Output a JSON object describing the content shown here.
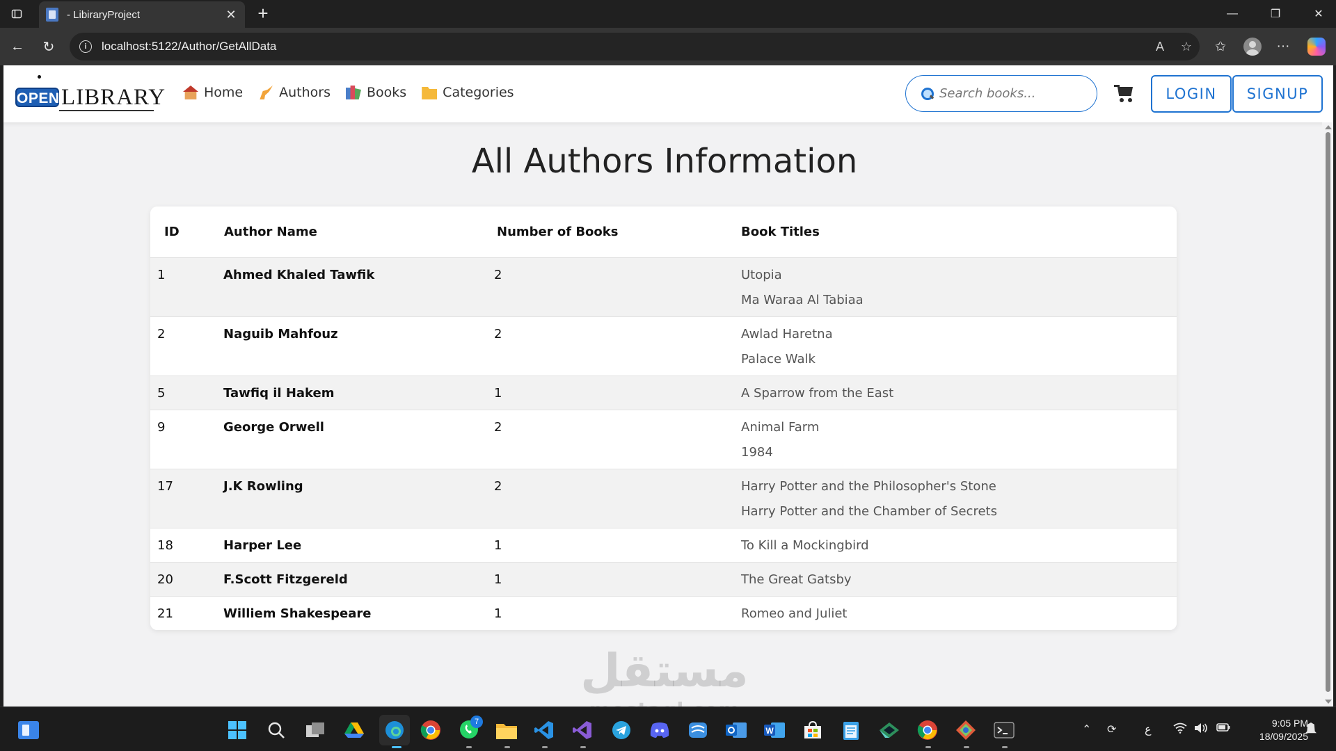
{
  "browser": {
    "tab_title": "- LibiraryProject",
    "url": "localhost:5122/Author/GetAllData"
  },
  "navbar": {
    "logo_open": "OPEN",
    "logo_library": "LIBRARY",
    "links": [
      {
        "label": "Home",
        "icon": "house-icon"
      },
      {
        "label": "Authors",
        "icon": "writing-hand-icon"
      },
      {
        "label": "Books",
        "icon": "books-icon"
      },
      {
        "label": "Categories",
        "icon": "folder-icon"
      }
    ],
    "search_placeholder": "Search books...",
    "login_label": "LOGIN",
    "signup_label": "SIGNUP"
  },
  "page": {
    "title": "All Authors Information",
    "table": {
      "headers": {
        "id": "ID",
        "name": "Author Name",
        "count": "Number of Books",
        "titles": "Book Titles"
      },
      "rows": [
        {
          "id": "1",
          "name": "Ahmed Khaled Tawfik",
          "count": "2",
          "titles": [
            "Utopia",
            "Ma Waraa Al Tabiaa"
          ]
        },
        {
          "id": "2",
          "name": "Naguib Mahfouz",
          "count": "2",
          "titles": [
            "Awlad Haretna",
            "Palace Walk"
          ]
        },
        {
          "id": "5",
          "name": "Tawfiq il Hakem",
          "count": "1",
          "titles": [
            "A Sparrow from the East"
          ]
        },
        {
          "id": "9",
          "name": "George Orwell",
          "count": "2",
          "titles": [
            "Animal Farm",
            "1984"
          ]
        },
        {
          "id": "17",
          "name": "J.K Rowling",
          "count": "2",
          "titles": [
            "Harry Potter and the Philosopher's Stone",
            "Harry Potter and the Chamber of Secrets"
          ]
        },
        {
          "id": "18",
          "name": "Harper Lee",
          "count": "1",
          "titles": [
            "To Kill a Mockingbird"
          ]
        },
        {
          "id": "20",
          "name": "F.Scott Fitzgereld",
          "count": "1",
          "titles": [
            "The Great Gatsby"
          ]
        },
        {
          "id": "21",
          "name": "Williem Shakespeare",
          "count": "1",
          "titles": [
            "Romeo and Juliet"
          ]
        }
      ]
    }
  },
  "watermark": {
    "arabic": "مستقل",
    "latin": "mostaql.com"
  },
  "taskbar": {
    "time": "9:05 PM",
    "date": "18/09/2025",
    "whatsapp_badge": "7",
    "language": "ع"
  },
  "colors": {
    "accent": "#1f73d1",
    "page_bg": "#f2f2f3",
    "row_alt": "#f2f2f2"
  }
}
